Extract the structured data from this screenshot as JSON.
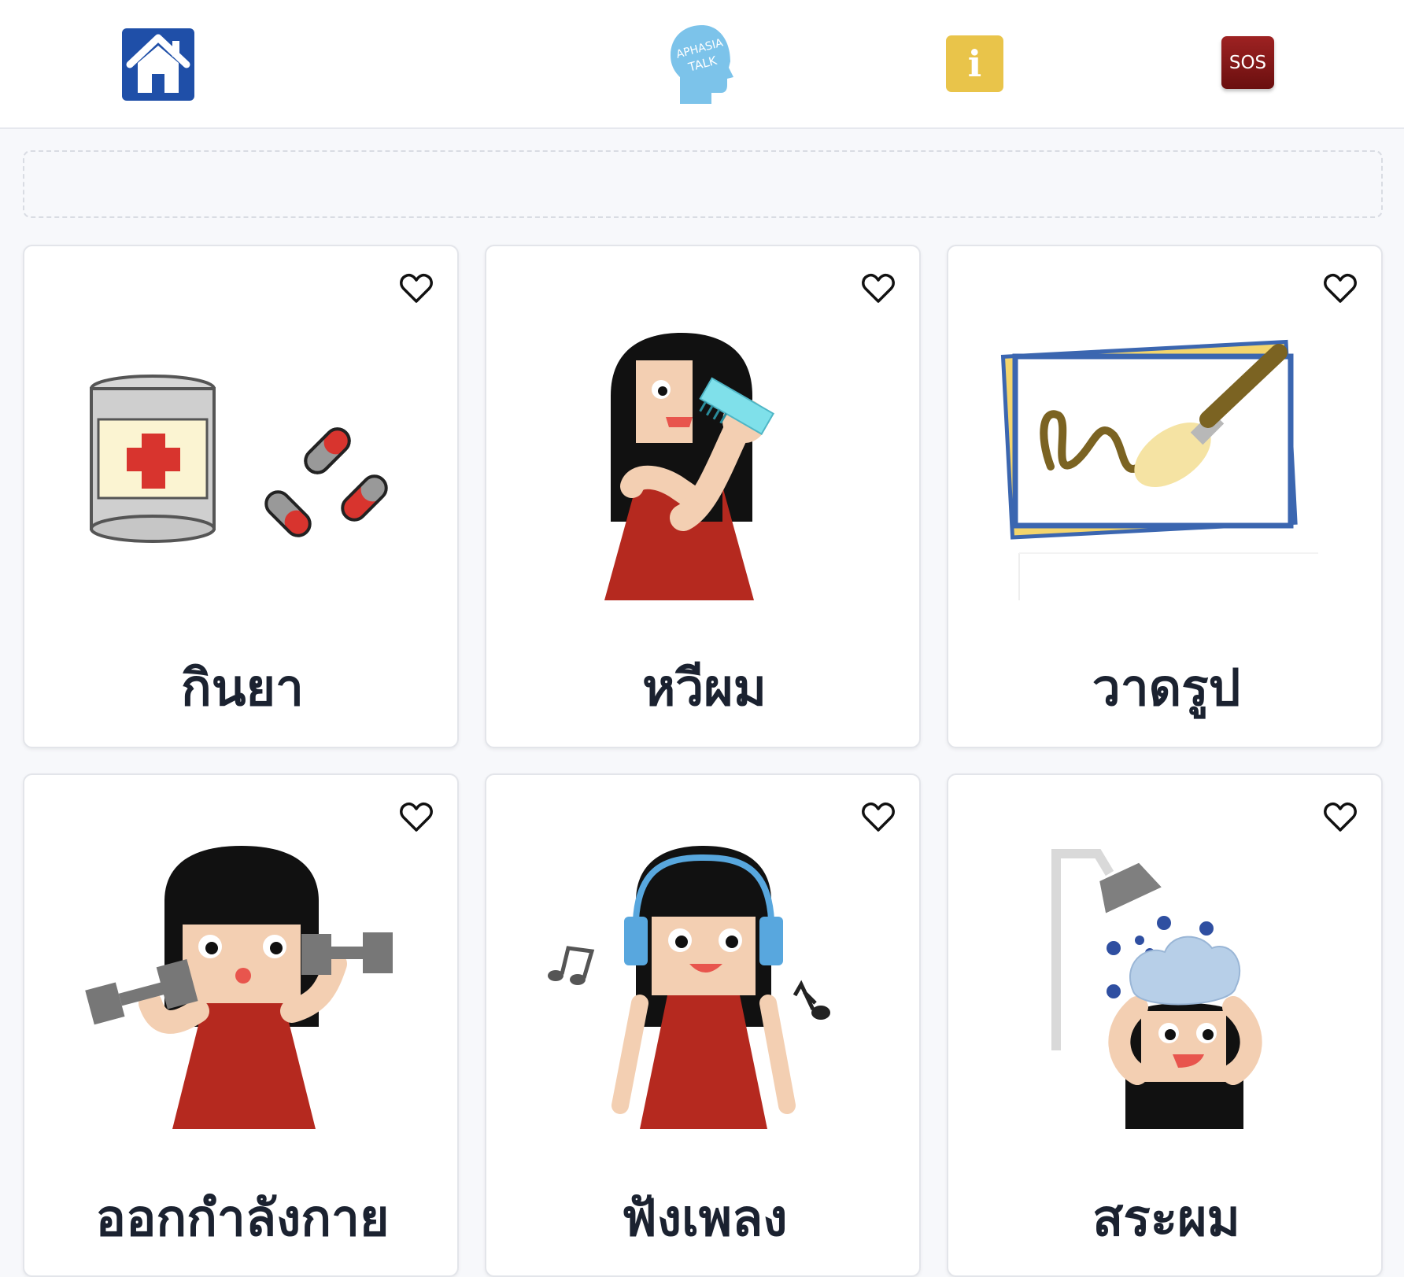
{
  "header": {
    "home_icon": "home-icon",
    "logo_text_1": "APHASIA",
    "logo_text_2": "TALK",
    "info_label": "i",
    "sos_label": "SOS",
    "accent_blue": "#1f4fa8",
    "info_yellow": "#e9c44a",
    "sos_red": "#8b1a1a"
  },
  "cards": [
    {
      "label": "กินยา",
      "icon": "medicine-icon"
    },
    {
      "label": "หวีผม",
      "icon": "comb-hair-icon"
    },
    {
      "label": "วาดรูป",
      "icon": "paint-icon"
    },
    {
      "label": "ออกกำลังกาย",
      "icon": "exercise-icon"
    },
    {
      "label": "ฟังเพลง",
      "icon": "music-icon"
    },
    {
      "label": "สระผม",
      "icon": "shampoo-icon"
    }
  ]
}
